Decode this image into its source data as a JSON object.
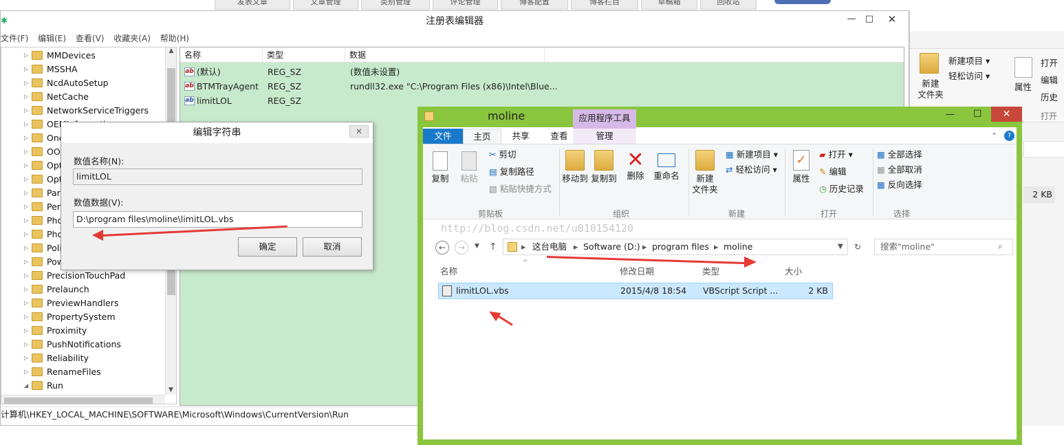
{
  "blog_tabs": [
    "发表文章",
    "文章管理",
    "类别管理",
    "评论管理",
    "博客配置",
    "博客栏目",
    "草稿箱",
    "回收站"
  ],
  "regedit": {
    "title": "注册表编辑器",
    "menu": [
      "文件(F)",
      "编辑(E)",
      "查看(V)",
      "收藏夹(A)",
      "帮助(H)"
    ],
    "tree": [
      "MMDevices",
      "MSSHA",
      "NcdAutoSetup",
      "NetCache",
      "NetworkServiceTriggers",
      "OEMInformation",
      "OneDriveSetup",
      "OOBE",
      "OptionalComponents",
      "OptimalLayout",
      "Parental Controls",
      "PenWorkspace",
      "PhotoPropertyHandler",
      "Photos",
      "Policies",
      "PowerEfficiencyDiagnostics",
      "PrecisionTouchPad",
      "Prelaunch",
      "PreviewHandlers",
      "PropertySystem",
      "Proximity",
      "PushNotifications",
      "Reliability",
      "RenameFiles",
      "Run"
    ],
    "columns": {
      "name": "名称",
      "type": "类型",
      "data": "数据"
    },
    "values": [
      {
        "name": "(默认)",
        "type": "REG_SZ",
        "data": "(数值未设置)"
      },
      {
        "name": "BTMTrayAgent",
        "type": "REG_SZ",
        "data": "rundll32.exe \"C:\\Program Files (x86)\\Intel\\Blue..."
      },
      {
        "name": "limitLOL",
        "type": "REG_SZ",
        "data": ""
      }
    ],
    "status": "计算机\\HKEY_LOCAL_MACHINE\\SOFTWARE\\Microsoft\\Windows\\CurrentVersion\\Run"
  },
  "dialog": {
    "title": "编辑字符串",
    "name_label": "数值名称(N):",
    "name_value": "limitLOL",
    "data_label": "数值数据(V):",
    "data_value": "D:\\program files\\moline\\limitLOL.vbs",
    "ok": "确定",
    "cancel": "取消"
  },
  "bg_explorer": {
    "new_folder": "新建\n文件夹",
    "new_item": "新建项目 ▾",
    "easy_access": "轻松访问 ▾",
    "properties": "属性",
    "open": "打开",
    "edit": "编辑",
    "history": "历史",
    "open_group": "打开",
    "size": "2 KB"
  },
  "explorer": {
    "title": "moline",
    "context_tab": "应用程序工具",
    "tabs": [
      "文件",
      "主页",
      "共享",
      "查看",
      "管理"
    ],
    "ribbon": {
      "copy": "复制",
      "paste": "粘贴",
      "cut": "剪切",
      "copy_path": "复制路径",
      "paste_shortcut": "粘贴快捷方式",
      "clipboard": "剪贴板",
      "move_to": "移动到",
      "copy_to": "复制到",
      "delete": "删除",
      "rename": "重命名",
      "organize": "组织",
      "new_folder": "新建\n文件夹",
      "new_item": "新建项目 ▾",
      "easy_access": "轻松访问 ▾",
      "new_group": "新建",
      "properties": "属性",
      "open": "打开 ▾",
      "edit": "编辑",
      "history": "历史记录",
      "open_group": "打开",
      "select_all": "全部选择",
      "select_none": "全部取消",
      "invert": "反向选择",
      "select_group": "选择"
    },
    "watermark": "http://blog.csdn.net/u010154120",
    "breadcrumb": [
      "这台电脑",
      "Software (D:)",
      "program files",
      "moline"
    ],
    "search_placeholder": "搜索\"moline\"",
    "columns": {
      "name": "名称",
      "date": "修改日期",
      "type": "类型",
      "size": "大小"
    },
    "file": {
      "name": "limitLOL.vbs",
      "date": "2015/4/8 18:54",
      "type": "VBScript Script ...",
      "size": "2 KB"
    }
  }
}
